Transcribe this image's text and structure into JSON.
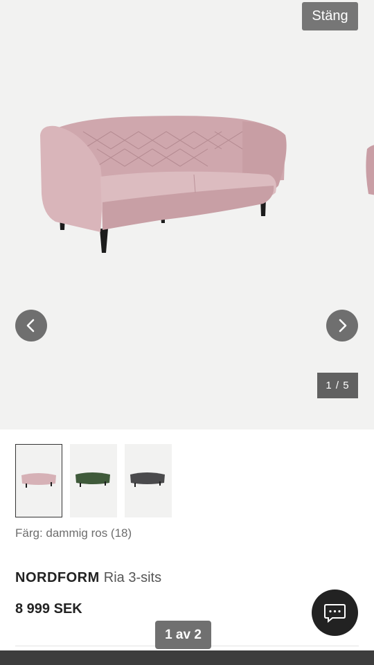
{
  "gallery": {
    "close_label": "Stäng",
    "counter": "1 / 5",
    "prev_icon": "chevron-left-icon",
    "next_icon": "chevron-right-icon"
  },
  "thumbnails": [
    {
      "name": "thumbnail-dusty-rose",
      "color": "#d8b3b8",
      "selected": true
    },
    {
      "name": "thumbnail-green",
      "color": "#3f5a3a",
      "selected": false
    },
    {
      "name": "thumbnail-grey",
      "color": "#4a4a4c",
      "selected": false
    }
  ],
  "product": {
    "color_label": "Färg: dammig ros (18)",
    "brand": "NORDFORM",
    "model": "Ria 3-sits",
    "price": "8 999 SEK"
  },
  "chat": {
    "icon": "chat-icon"
  },
  "pager": {
    "label": "1 av 2"
  },
  "colors": {
    "sofa_main": "#d4afb5",
    "sofa_shadow": "#b98f96",
    "legs": "#1c1c1c",
    "button_gray": "#707070"
  }
}
